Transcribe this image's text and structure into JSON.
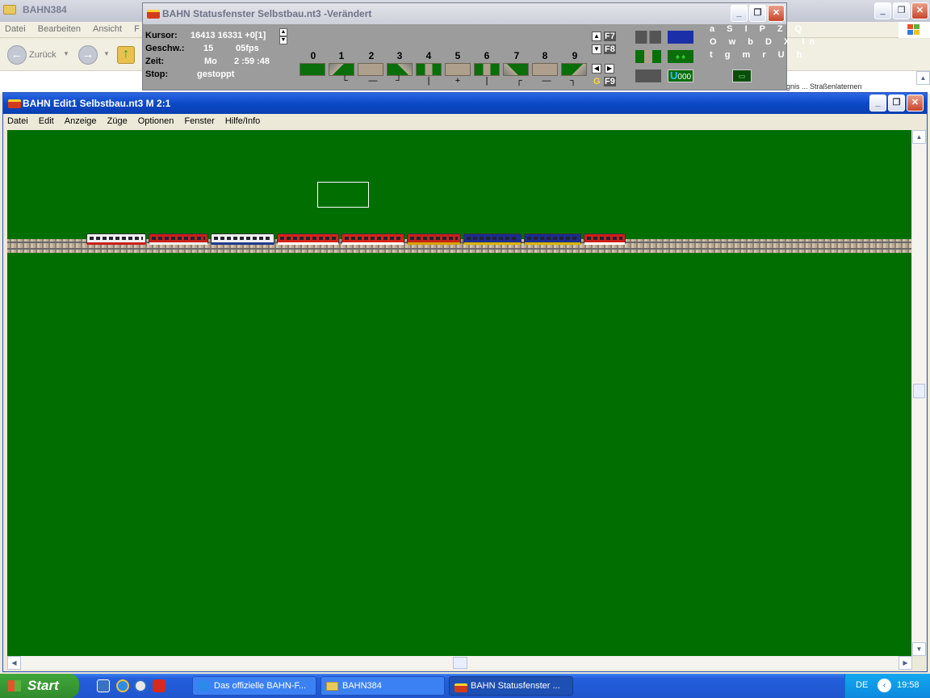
{
  "explorer": {
    "title": "BAHN384",
    "menu": [
      "Datei",
      "Bearbeiten",
      "Ansicht",
      "F"
    ],
    "back_label": "Zurück",
    "partial_text": "Ereignis ... Straßenlaternen"
  },
  "status_window": {
    "title": "BAHN Statusfenster Selbstbau.nt3 -Verändert",
    "labels": {
      "cursor": "Kursor:",
      "speed": "Geschw.:",
      "time": "Zeit:",
      "stop": "Stop:"
    },
    "cursor_value": "16413 16331 +0[1]",
    "speed_value": "15",
    "fps_value": "05fps",
    "day_value": "Mo",
    "time_value": "2 :59 :48",
    "stop_value": "gestoppt",
    "track_numbers": [
      "0",
      "1",
      "2",
      "3",
      "4",
      "5",
      "6",
      "7",
      "8",
      "9"
    ],
    "track_symbols": [
      "",
      "└",
      "—",
      "┘",
      "|",
      "+",
      "|",
      "┌",
      "—",
      "┐"
    ],
    "fkeys": [
      "F7",
      "F8",
      "F9"
    ],
    "g_label": "G",
    "counter_value": "000",
    "letters_row1": "a S I P Z Q",
    "letters_row2": "O w b D X In",
    "letters_row3": "t g m r U h"
  },
  "edit_window": {
    "title": "BAHN Edit1 Selbstbau.nt3 M 2:1",
    "menu": [
      "Datei",
      "Edit",
      "Anzeige",
      "Züge",
      "Optionen",
      "Fenster",
      "Hilfe/Info"
    ],
    "canvas_color": "#006e00",
    "train_cars": [
      {
        "body": "#f0f0f0",
        "stripe": "#c8201a"
      },
      {
        "body": "#c8201a",
        "stripe": "#f0f0f0"
      },
      {
        "body": "#f0f0f0",
        "stripe": "#1f3b8c"
      },
      {
        "body": "#d42417",
        "stripe": "#ffffff"
      },
      {
        "body": "#d42417",
        "stripe": "#ffffff"
      },
      {
        "body": "#c8201a",
        "stripe": "#d9a300"
      },
      {
        "body": "#1b2d8f",
        "stripe": "#d9b400"
      },
      {
        "body": "#1b2d8f",
        "stripe": "#d9b400"
      },
      {
        "body": "#cc1f15",
        "stripe": "#ffffff"
      }
    ]
  },
  "taskbar": {
    "start_label": "Start",
    "tasks": [
      "Das offizielle BAHN-F...",
      "BAHN384",
      "BAHN Statusfenster ..."
    ],
    "lang": "DE",
    "clock": "19:58"
  }
}
